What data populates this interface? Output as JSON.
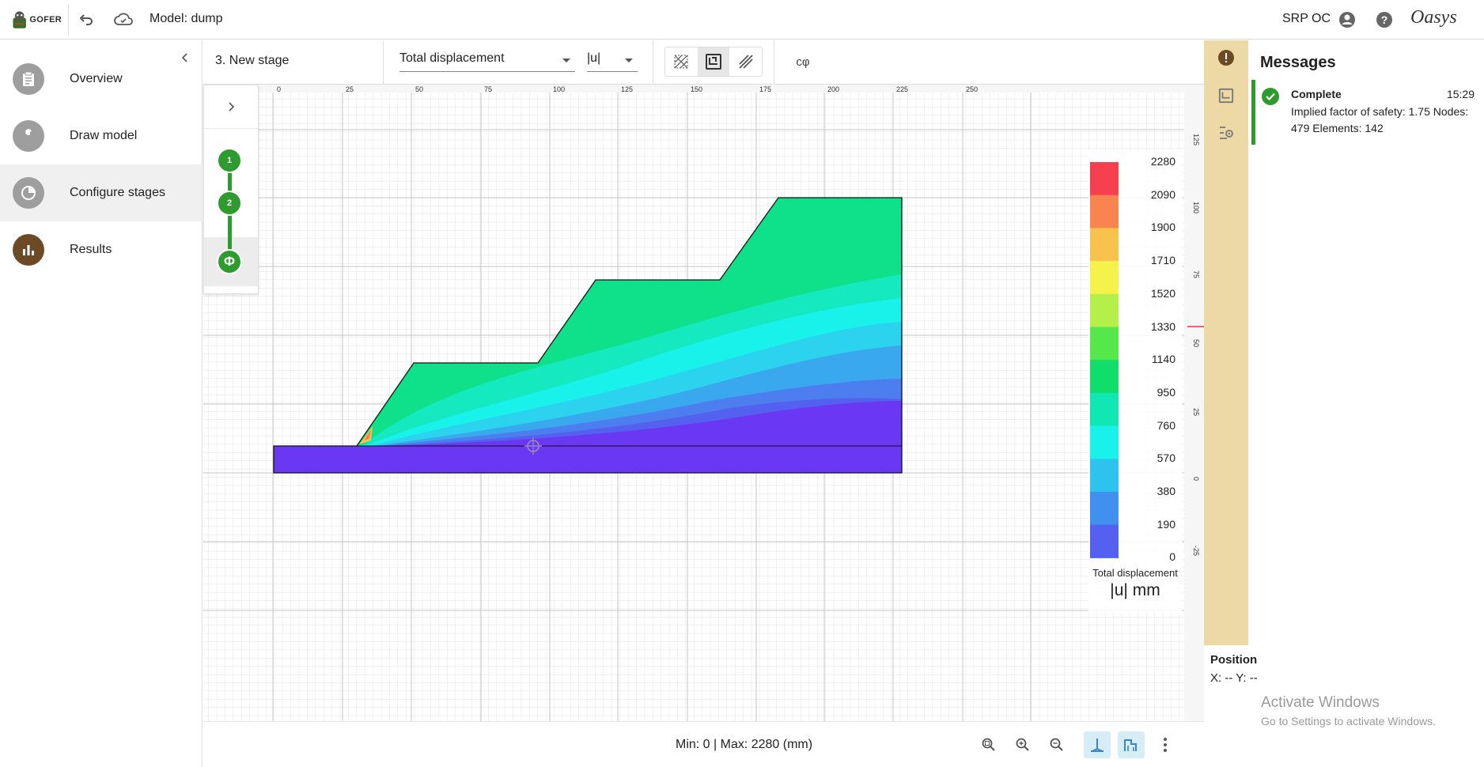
{
  "app": {
    "logo_text": "GOFER",
    "model_title": "Model: dump",
    "user": "SRP OC",
    "brand": "Oasys"
  },
  "sidebar": {
    "items": [
      {
        "label": "Overview",
        "icon": "clipboard-icon"
      },
      {
        "label": "Draw model",
        "icon": "wrench-icon"
      },
      {
        "label": "Configure stages",
        "icon": "stages-icon"
      },
      {
        "label": "Results",
        "icon": "bar-chart-icon"
      }
    ],
    "active": "Configure stages"
  },
  "toolbar": {
    "stage_name": "3. New stage",
    "result_type": "Total displacement",
    "component": "|u|",
    "cphi_label": "cφ"
  },
  "stages": {
    "items": [
      "1",
      "2",
      "Φ"
    ]
  },
  "ruler": {
    "top_ticks": [
      "0",
      "25",
      "50",
      "75",
      "100",
      "125",
      "150",
      "175",
      "200",
      "225",
      "250"
    ],
    "right_ticks": [
      "125",
      "100",
      "75",
      "50",
      "25",
      "0",
      "-25"
    ]
  },
  "legend": {
    "values": [
      "2280",
      "2090",
      "1900",
      "1710",
      "1520",
      "1330",
      "1140",
      "950",
      "760",
      "570",
      "380",
      "190",
      "0"
    ],
    "colors": [
      "#f7404f",
      "#f8844f",
      "#f9c24d",
      "#f4f24b",
      "#b4f04a",
      "#56e84a",
      "#10de6a",
      "#10e8b4",
      "#18f2ea",
      "#2cc4ee",
      "#4190f0",
      "#5360f0",
      "#6a38f2"
    ],
    "caption": "Total displacement",
    "units": "|u| mm"
  },
  "bottom": {
    "minmax": "Min: 0 | Max: 2280 (mm)"
  },
  "messages": {
    "title": "Messages",
    "items": [
      {
        "status": "Complete",
        "time": "15:29",
        "text": "Implied factor of safety: 1.75 Nodes: 479 Elements: 142"
      }
    ]
  },
  "position": {
    "title": "Position",
    "xy": "X: -- Y: --"
  },
  "watermark": {
    "line1": "Activate Windows",
    "line2": "Go to Settings to activate Windows."
  }
}
